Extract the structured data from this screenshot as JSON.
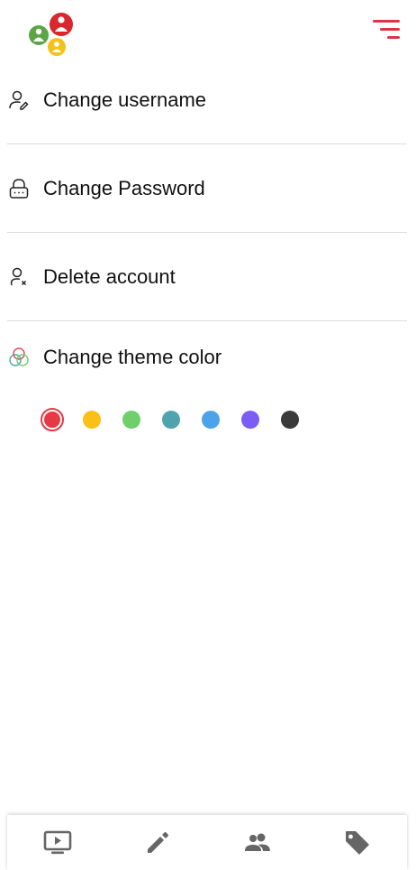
{
  "header": {
    "logo_icon": "people-circles-logo",
    "menu_icon": "filter-menu-icon",
    "accent_color": "#dc3545"
  },
  "settings": {
    "items": [
      {
        "label": "Change username",
        "icon": "user-edit-icon"
      },
      {
        "label": "Change Password",
        "icon": "lock-icon"
      },
      {
        "label": "Delete account",
        "icon": "user-remove-icon"
      },
      {
        "label": "Change theme color",
        "icon": "color-circles-icon"
      }
    ]
  },
  "theme_colors": {
    "selected_index": 0,
    "options": [
      "#e63946",
      "#fbc013",
      "#6fcf6b",
      "#4fa3ad",
      "#4da3ea",
      "#7b5cf6",
      "#3a3a3a"
    ]
  },
  "bottom_nav": {
    "items": [
      {
        "icon": "play-screen-icon"
      },
      {
        "icon": "pencil-icon"
      },
      {
        "icon": "people-icon"
      },
      {
        "icon": "tag-icon"
      }
    ],
    "icon_color": "#666666"
  }
}
